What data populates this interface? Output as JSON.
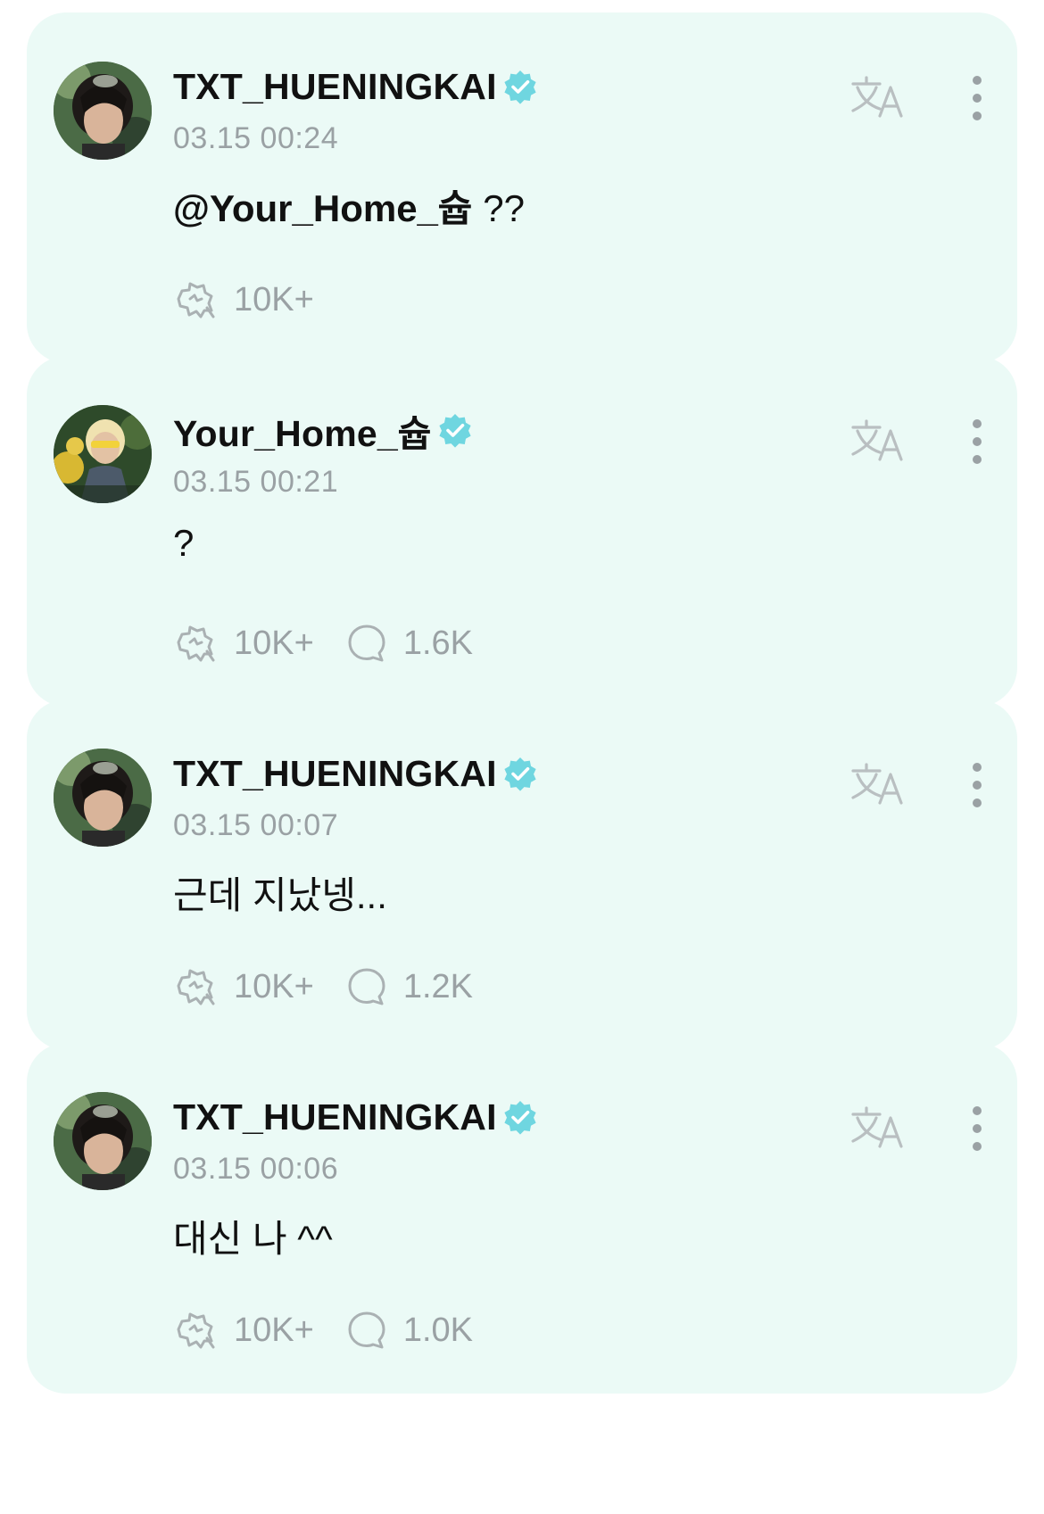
{
  "posts": [
    {
      "author": "TXT_HUENINGKAI",
      "timestamp": "03.15 00:24",
      "body_mention": "@Your_Home_슙",
      "body_text": " ??",
      "likes": "10K+",
      "comments": ""
    },
    {
      "author": "Your_Home_슙",
      "timestamp": "03.15 00:21",
      "body_mention": "",
      "body_text": "?",
      "likes": "10K+",
      "comments": "1.6K"
    },
    {
      "author": "TXT_HUENINGKAI",
      "timestamp": "03.15 00:07",
      "body_mention": "",
      "body_text": "근데 지났넹...",
      "likes": "10K+",
      "comments": "1.2K"
    },
    {
      "author": "TXT_HUENINGKAI",
      "timestamp": "03.15 00:06",
      "body_mention": "",
      "body_text": "대신 나 ^^",
      "likes": "10K+",
      "comments": "1.0K"
    }
  ],
  "colors": {
    "card_background": "#ebfaf6",
    "verified_badge": "#6fd6e0",
    "muted_text": "#9aa1a4"
  },
  "icons": {
    "verified": "verified-badge-icon",
    "translate": "translate-icon",
    "more": "more-vertical-icon",
    "like": "like-icon",
    "comment": "comment-bubble-icon"
  }
}
